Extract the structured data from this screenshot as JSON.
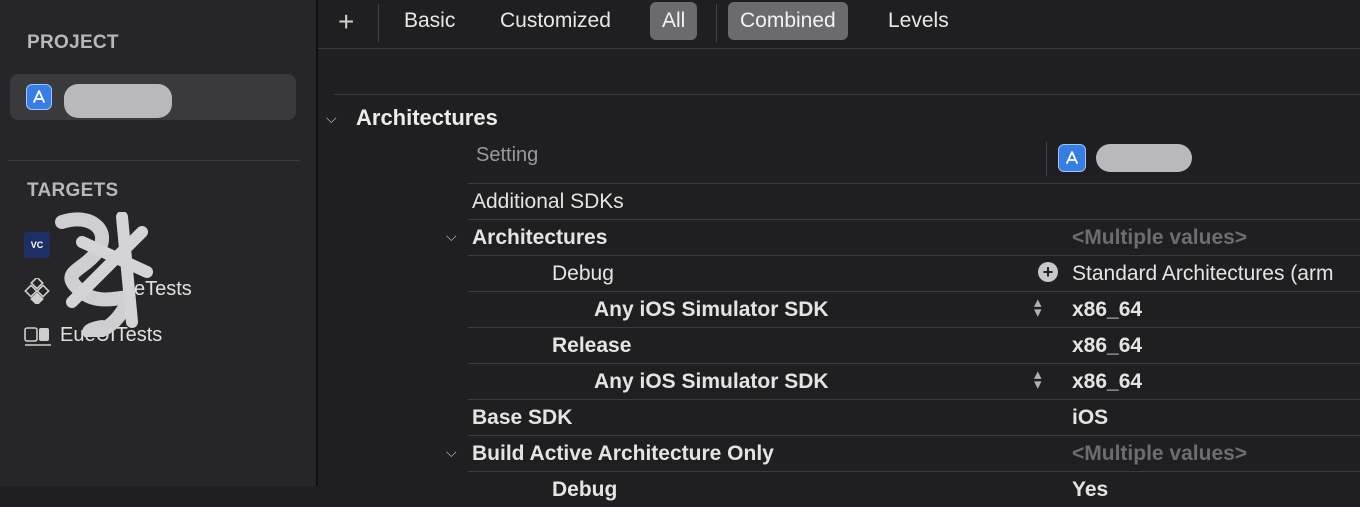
{
  "sidebar": {
    "project_title": "PROJECT",
    "targets_title": "TARGETS",
    "targets": [
      {
        "label": "e",
        "icon": "vc-app-icon"
      },
      {
        "label": "eTests",
        "icon": "test-diamond-icon"
      },
      {
        "label": "EueUITests",
        "icon": "ui-test-icon"
      }
    ]
  },
  "toolbar": {
    "add_label": "+",
    "tabs": [
      "Basic",
      "Customized",
      "All",
      "Combined",
      "Levels"
    ]
  },
  "section": {
    "title": "Architectures",
    "setting_header": "Setting"
  },
  "rows": [
    {
      "name": "Additional SDKs",
      "value": ""
    },
    {
      "name": "Architectures",
      "value": "<Multiple values>"
    },
    {
      "name": "Debug",
      "value": "Standard Architectures (arm"
    },
    {
      "name": "Any iOS Simulator SDK",
      "value": "x86_64"
    },
    {
      "name": "Release",
      "value": "x86_64"
    },
    {
      "name": "Any iOS Simulator SDK",
      "value": "x86_64"
    },
    {
      "name": "Base SDK",
      "value": "iOS"
    },
    {
      "name": "Build Active Architecture Only",
      "value": "<Multiple values>"
    },
    {
      "name": "Debug",
      "value": "Yes"
    }
  ],
  "colors": {
    "accent": "#3a7de0",
    "active_tab": "#6b6b6f"
  }
}
